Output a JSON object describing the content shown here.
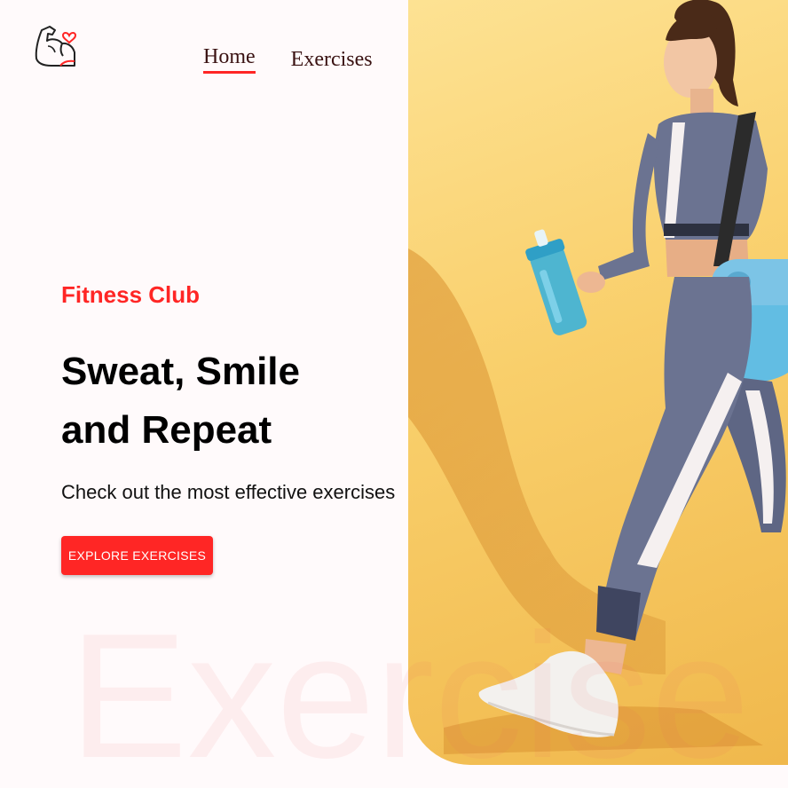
{
  "navbar": {
    "logo_icon": "flexed-arm-heart-icon",
    "links": [
      {
        "label": "Home",
        "active": true
      },
      {
        "label": "Exercises",
        "active": false
      }
    ]
  },
  "hero": {
    "eyebrow": "Fitness Club",
    "headline_line1": "Sweat, Smile",
    "headline_line2": "and Repeat",
    "subtitle": "Check out the most effective exercises",
    "cta_label": "EXPLORE EXERCISES",
    "background_word": "Exercise",
    "image": "woman-walking-with-shaker-and-gym-bag"
  },
  "colors": {
    "accent": "#ff2625",
    "background": "#fffafb",
    "photo_background": "#fbd97a"
  }
}
